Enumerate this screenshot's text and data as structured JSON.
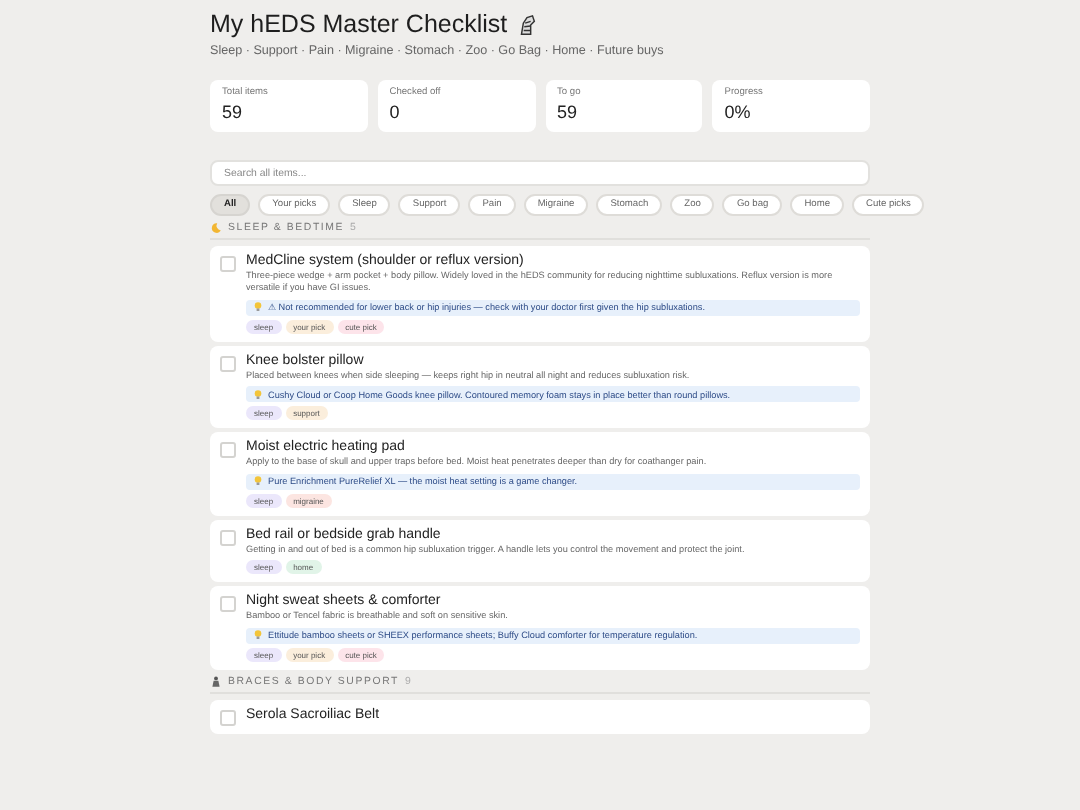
{
  "header": {
    "title": "My hEDS Master Checklist",
    "subtitle": "Sleep · Support · Pain · Migraine · Stomach · Zoo · Go Bag · Home · Future buys"
  },
  "stats": [
    {
      "label": "Total items",
      "value": "59"
    },
    {
      "label": "Checked off",
      "value": "0"
    },
    {
      "label": "To go",
      "value": "59"
    },
    {
      "label": "Progress",
      "value": "0%"
    }
  ],
  "search": {
    "placeholder": "Search all items..."
  },
  "filters": [
    {
      "label": "All",
      "selected": true
    },
    {
      "label": "Your picks",
      "selected": false
    },
    {
      "label": "Sleep",
      "selected": false
    },
    {
      "label": "Support",
      "selected": false
    },
    {
      "label": "Pain",
      "selected": false
    },
    {
      "label": "Migraine",
      "selected": false
    },
    {
      "label": "Stomach",
      "selected": false
    },
    {
      "label": "Zoo",
      "selected": false
    },
    {
      "label": "Go bag",
      "selected": false
    },
    {
      "label": "Home",
      "selected": false
    },
    {
      "label": "Cute picks",
      "selected": false
    }
  ],
  "sections": [
    {
      "kind": "moon",
      "title": "SLEEP & BEDTIME",
      "count": "5",
      "items": [
        {
          "title": "MedCline system (shoulder or reflux version)",
          "checked": false,
          "description": "Three-piece wedge + arm pocket + body pillow. Widely loved in the hEDS community for reducing nighttime subluxations. Reflux version is more versatile if you have GI issues.",
          "tip": "⚠ Not recommended for lower back or hip injuries — check with your doctor first given the hip subluxations.",
          "tags": [
            {
              "label": "sleep",
              "color": "#ebe7fb"
            },
            {
              "label": "your pick",
              "color": "#fbeedc"
            },
            {
              "label": "cute pick",
              "color": "#fde4ea"
            }
          ]
        },
        {
          "title": "Knee bolster pillow",
          "checked": false,
          "description": "Placed between knees when side sleeping — keeps right hip in neutral all night and reduces subluxation risk.",
          "tip": "Cushy Cloud or Coop Home Goods knee pillow. Contoured memory foam stays in place better than round pillows.",
          "tags": [
            {
              "label": "sleep",
              "color": "#ebe7fb"
            },
            {
              "label": "support",
              "color": "#fbeedc"
            }
          ]
        },
        {
          "title": "Moist electric heating pad",
          "checked": false,
          "description": "Apply to the base of skull and upper traps before bed. Moist heat penetrates deeper than dry for coathanger pain.",
          "tip": "Pure Enrichment PureRelief XL — the moist heat setting is a game changer.",
          "tags": [
            {
              "label": "sleep",
              "color": "#ebe7fb"
            },
            {
              "label": "migraine",
              "color": "#fce5e1"
            }
          ]
        },
        {
          "title": "Bed rail or bedside grab handle",
          "checked": false,
          "description": "Getting in and out of bed is a common hip subluxation trigger. A handle lets you control the movement and protect the joint.",
          "tags": [
            {
              "label": "sleep",
              "color": "#ebe7fb"
            },
            {
              "label": "home",
              "color": "#e1f4e8"
            }
          ]
        },
        {
          "title": "Night sweat sheets & comforter",
          "checked": false,
          "description": "Bamboo or Tencel fabric is breathable and soft on sensitive skin.",
          "tip": "Ettitude bamboo sheets or SHEEX performance sheets; Buffy Cloud comforter for temperature regulation.",
          "tags": [
            {
              "label": "sleep",
              "color": "#ebe7fb"
            },
            {
              "label": "your pick",
              "color": "#fbeedc"
            },
            {
              "label": "cute pick",
              "color": "#fde4ea"
            }
          ]
        }
      ]
    },
    {
      "kind": "figure",
      "title": "BRACES & BODY SUPPORT",
      "count": "9",
      "items": [
        {
          "title": "Serola Sacroiliac Belt",
          "checked": false
        }
      ]
    }
  ]
}
